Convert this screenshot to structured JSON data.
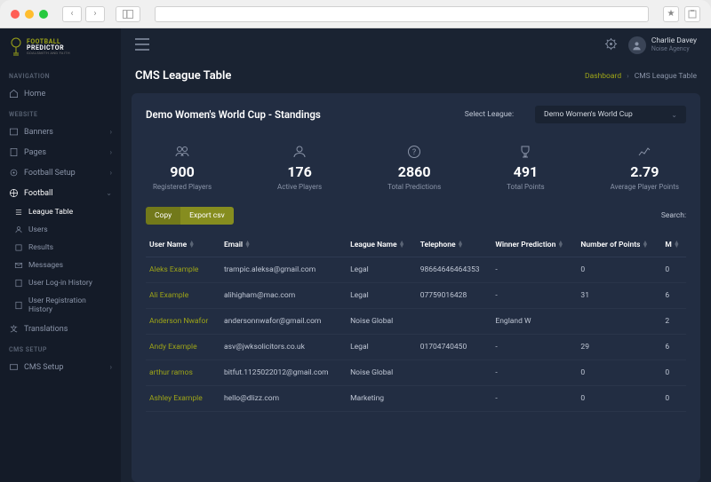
{
  "chrome": {
    "star": "★",
    "back": "‹",
    "forward": "›"
  },
  "logo": {
    "top": "FOOTBALL",
    "bot": "PREDICTOR",
    "sub": "GOALSMITH AND FAITH"
  },
  "sidebar": {
    "sections": {
      "nav": "NAVIGATION",
      "website": "WEBSITE",
      "cms": "CMS SETUP"
    },
    "home": "Home",
    "banners": "Banners",
    "pages": "Pages",
    "football_setup": "Football Setup",
    "football": "Football",
    "submenu": {
      "league_table": "League Table",
      "users": "Users",
      "results": "Results",
      "messages": "Messages",
      "login_history": "User Log-in History",
      "reg_history": "User Registration History"
    },
    "translations": "Translations",
    "cms_setup": "CMS Setup"
  },
  "topbar": {
    "user_name": "Charlie Davey",
    "user_org": "Noise Agency"
  },
  "header": {
    "title": "CMS League Table",
    "crumbs": {
      "dashboard": "Dashboard",
      "current": "CMS League Table"
    }
  },
  "standings": {
    "title": "Demo Women's World Cup - Standings",
    "league_label": "Select League:",
    "league_value": "Demo Women's World Cup"
  },
  "stats": [
    {
      "value": "900",
      "label": "Registered Players"
    },
    {
      "value": "176",
      "label": "Active Players"
    },
    {
      "value": "2860",
      "label": "Total Predictions"
    },
    {
      "value": "491",
      "label": "Total Points"
    },
    {
      "value": "2.79",
      "label": "Average Player Points"
    }
  ],
  "toolbar": {
    "copy": "Copy",
    "export": "Export csv",
    "search": "Search:"
  },
  "table": {
    "headers": [
      "User Name",
      "Email",
      "League Name",
      "Telephone",
      "Winner Prediction",
      "Number of Points",
      "M"
    ],
    "rows": [
      {
        "name": "Aleks Example",
        "email": "trampic.aleksa@gmail.com",
        "league": "Legal",
        "tel": "98664646464353",
        "winner": "-",
        "points": "0",
        "m": "0"
      },
      {
        "name": "Ali Example",
        "email": "alihigham@mac.com",
        "league": "Legal",
        "tel": "07759016428",
        "winner": "-",
        "points": "31",
        "m": "6"
      },
      {
        "name": "Anderson Nwafor",
        "email": "andersonnwafor@gmail.com",
        "league": "Noise Global",
        "tel": "",
        "winner": "England W",
        "points": "",
        "m": "2"
      },
      {
        "name": "Andy Example",
        "email": "asv@jwksolicitors.co.uk",
        "league": "Legal",
        "tel": "01704740450",
        "winner": "-",
        "points": "29",
        "m": "6"
      },
      {
        "name": "arthur ramos",
        "email": "bitfut.1125022012@gmail.com",
        "league": "Noise Global",
        "tel": "",
        "winner": "-",
        "points": "0",
        "m": "0"
      },
      {
        "name": "Ashley Example",
        "email": "hello@dlizz.com",
        "league": "Marketing",
        "tel": "",
        "winner": "-",
        "points": "0",
        "m": "0"
      }
    ]
  }
}
